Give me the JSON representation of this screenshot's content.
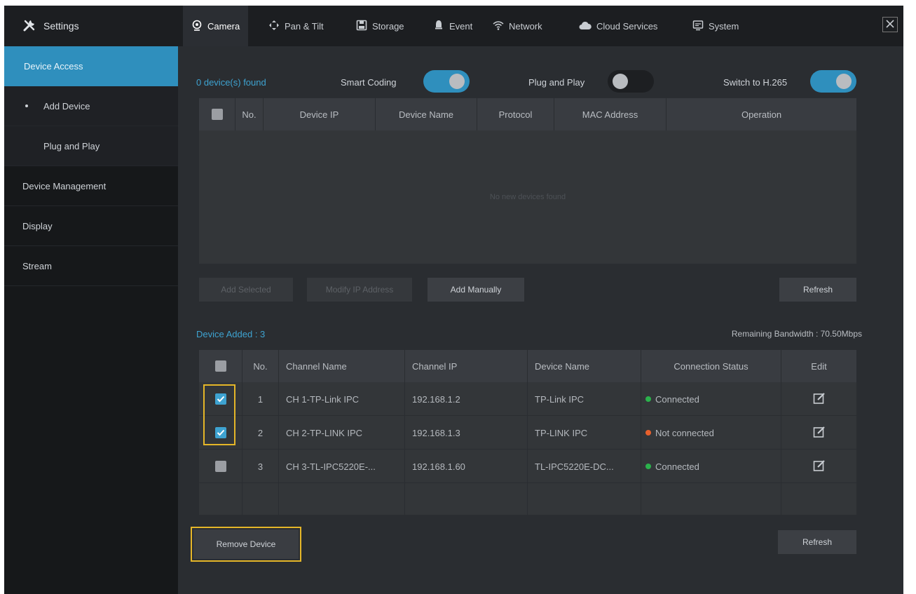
{
  "header": {
    "settings_label": "Settings",
    "tabs": [
      {
        "label": "Camera",
        "icon": "camera-icon"
      },
      {
        "label": "Pan & Tilt",
        "icon": "pan-tilt-icon"
      },
      {
        "label": "Storage",
        "icon": "storage-icon"
      },
      {
        "label": "Event",
        "icon": "event-icon"
      },
      {
        "label": "Network",
        "icon": "network-icon"
      },
      {
        "label": "Cloud Services",
        "icon": "cloud-icon"
      },
      {
        "label": "System",
        "icon": "system-icon"
      }
    ],
    "active_tab": "Camera"
  },
  "sidebar": {
    "items": [
      {
        "label": "Device Access",
        "active": true
      },
      {
        "label": "Add Device",
        "sub": true
      },
      {
        "label": "Plug and Play",
        "sub": true
      },
      {
        "label": "Device Management"
      },
      {
        "label": "Display"
      },
      {
        "label": "Stream"
      }
    ]
  },
  "search": {
    "found_label": "0 device(s) found",
    "smart_coding_label": "Smart Coding",
    "smart_coding_on": true,
    "plug_and_play_label": "Plug and Play",
    "plug_and_play_on": false,
    "switch_h265_label": "Switch to H.265",
    "switch_h265_on": true,
    "columns": [
      "No.",
      "Device IP",
      "Device Name",
      "Protocol",
      "MAC Address",
      "Operation"
    ],
    "empty_text": "No new devices found",
    "buttons": {
      "add_selected": "Add Selected",
      "modify_ip": "Modify IP Address",
      "add_manually": "Add Manually",
      "refresh": "Refresh"
    }
  },
  "added": {
    "title": "Device Added : 3",
    "bandwidth": "Remaining Bandwidth : 70.50Mbps",
    "columns": [
      "No.",
      "Channel Name",
      "Channel IP",
      "Device Name",
      "Connection Status",
      "Edit"
    ],
    "rows": [
      {
        "checked": true,
        "no": "1",
        "channel_name": "CH 1-TP-Link IPC",
        "channel_ip": "192.168.1.2",
        "device_name": "TP-Link IPC",
        "status": "Connected",
        "status_color": "#2bb24c"
      },
      {
        "checked": true,
        "no": "2",
        "channel_name": "CH 2-TP-LINK IPC",
        "channel_ip": "192.168.1.3",
        "device_name": "TP-LINK IPC",
        "status": "Not connected",
        "status_color": "#e8602c"
      },
      {
        "checked": false,
        "no": "3",
        "channel_name": "CH 3-TL-IPC5220E-...",
        "channel_ip": "192.168.1.60",
        "device_name": "TL-IPC5220E-DC...",
        "status": "Connected",
        "status_color": "#2bb24c"
      }
    ],
    "buttons": {
      "remove": "Remove Device",
      "refresh": "Refresh"
    }
  },
  "colors": {
    "accent": "#2f8fbd",
    "highlight": "#e5b628"
  }
}
